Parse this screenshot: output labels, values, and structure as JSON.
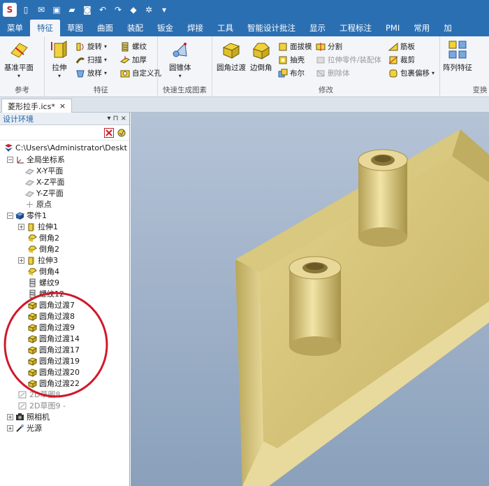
{
  "tabs": [
    "菜单",
    "特征",
    "草图",
    "曲面",
    "装配",
    "钣金",
    "焊接",
    "工具",
    "智能设计批注",
    "显示",
    "工程标注",
    "PMI",
    "常用",
    "加"
  ],
  "active_tab": "特征",
  "ribbon": {
    "reference": {
      "label": "参考",
      "datum_plane": "基准平面"
    },
    "feature": {
      "label": "特征",
      "extrude": "拉伸",
      "revolve": "旋转",
      "sweep": "扫描",
      "loft": "放样",
      "thread": "螺纹",
      "thicken": "加厚",
      "custom_hole": "自定义孔"
    },
    "quick": {
      "label": "快速生成图素",
      "cone": "圆锥体"
    },
    "modify": {
      "label": "修改",
      "fillet": "圆角过渡",
      "chamfer": "边倒角",
      "draft": "面拔模",
      "shell": "抽壳",
      "boolean": "布尔",
      "split": "分割",
      "extrude_part": "拉伸零件/装配体",
      "delete_body": "删除体",
      "rib": "筋板",
      "trim": "裁剪",
      "wrap_offset": "包裹偏移"
    },
    "transform": {
      "label": "变换",
      "pattern": "阵列特征"
    }
  },
  "document_tab": {
    "title": "菱形拉手.ics*",
    "close": "×"
  },
  "panel": {
    "title": "设计环境",
    "pin": "▾ ⊓ ×",
    "tree": {
      "root": "C:\\Users\\Administrator\\Deskt",
      "global_cs": "全局坐标系",
      "planes": [
        "X-Y平面",
        "X-Z平面",
        "Y-Z平面",
        "原点"
      ],
      "part": "零件1",
      "features": [
        "拉伸1",
        "倒角2",
        "倒角2",
        "拉伸3",
        "倒角4",
        "螺纹9",
        "螺纹12",
        "圆角过渡7",
        "圆角过渡8",
        "圆角过渡9",
        "圆角过渡14",
        "圆角过渡17",
        "圆角过渡19",
        "圆角过渡20",
        "圆角过渡22"
      ],
      "sketches": [
        "2D草图8 -",
        "2D草图9 -"
      ],
      "camera": "照相机",
      "light": "光源"
    }
  },
  "colors": {
    "ribbon_blue": "#2b6fb3",
    "highlight_circle": "#d0182a",
    "part_gold": "#d6c47a"
  }
}
